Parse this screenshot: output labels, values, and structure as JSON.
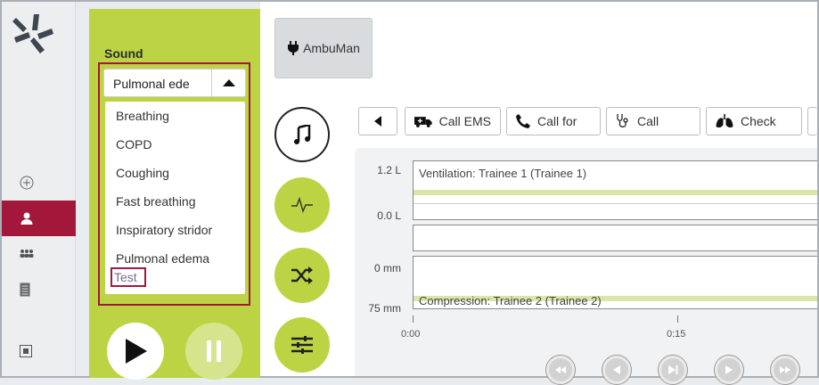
{
  "sound_panel": {
    "title": "Sound",
    "selected": "Pulmonal ede",
    "options": [
      "Breathing",
      "COPD",
      "Coughing",
      "Fast breathing",
      "Inspiratory stridor",
      "Pulmonal edema",
      "Test"
    ]
  },
  "device": {
    "label": "AmbuMan"
  },
  "toolbar": {
    "call_ems": "Call EMS",
    "call_for": "Call for",
    "call": "Call",
    "check": "Check"
  },
  "chart": {
    "ventilation_top": "1.2 L",
    "ventilation_bottom": "0.0 L",
    "ventilation_label": "Ventilation: Trainee 1 (Trainee 1)",
    "compression_top": "0 mm",
    "compression_bottom": "75 mm",
    "compression_label": "Compression: Trainee 2 (Trainee 2)",
    "time_ticks": [
      "0:00",
      "0:15"
    ]
  },
  "colors": {
    "brand_red": "#a3173a",
    "accent_green": "#bcd443"
  }
}
